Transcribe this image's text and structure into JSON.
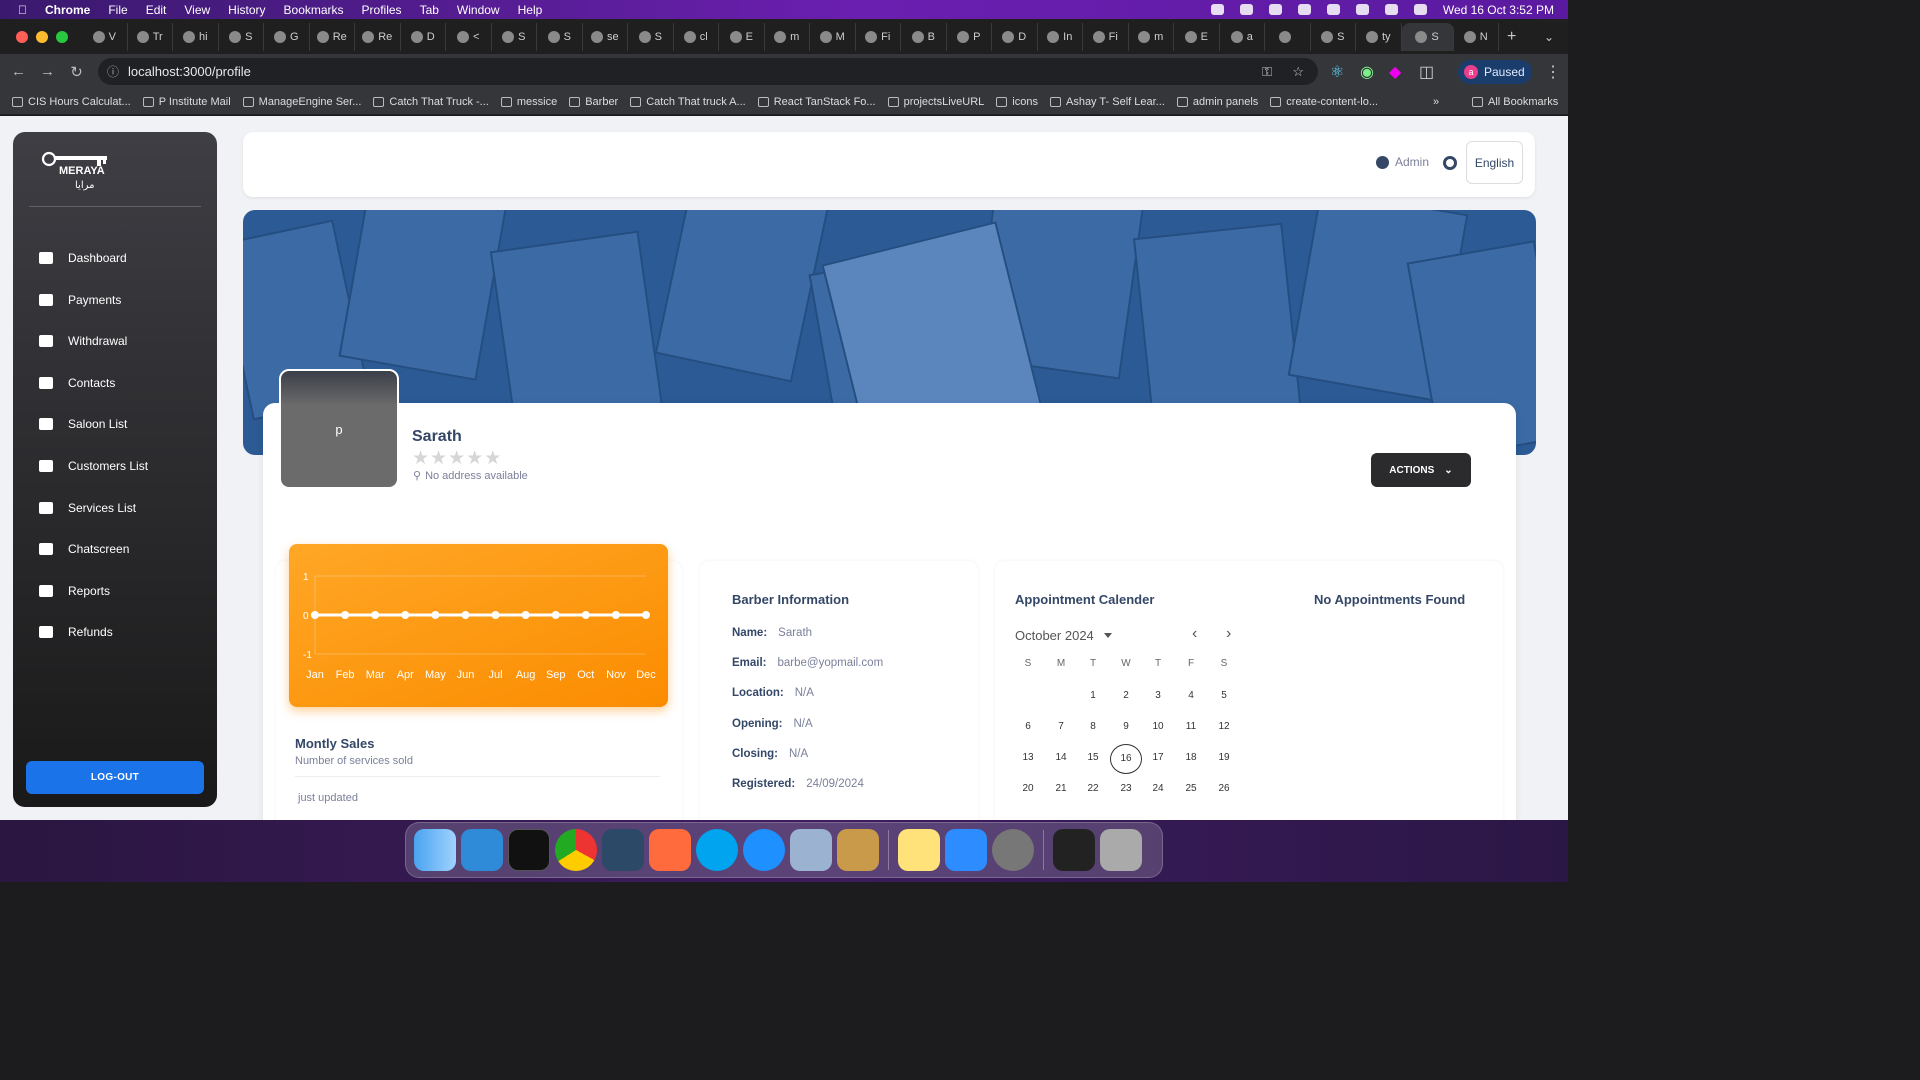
{
  "menubar": {
    "app": "Chrome",
    "items": [
      "File",
      "Edit",
      "View",
      "History",
      "Bookmarks",
      "Profiles",
      "Tab",
      "Window",
      "Help"
    ],
    "datetime": "Wed 16 Oct  3:52 PM"
  },
  "tabs": [
    "V",
    "Tr",
    "hi",
    "S",
    "G",
    "Re",
    "Re",
    "D",
    "<",
    "S",
    "S",
    "se",
    "S",
    "cl",
    "E",
    "m",
    "M",
    "Fi",
    "B",
    "P",
    "D",
    "In",
    "Fi",
    "m",
    "E",
    "a",
    "",
    "S",
    "ty",
    "S",
    "N"
  ],
  "address": {
    "url": "localhost:3000/profile",
    "paused": "Paused",
    "paused_avatar": "a"
  },
  "bookmarks": [
    "CIS Hours Calculat...",
    "P Institute Mail",
    "ManageEngine Ser...",
    "Catch That Truck -...",
    "messice",
    "Barber",
    "Catch That truck A...",
    "React TanStack Fo...",
    "projectsLiveURL",
    "icons",
    "Ashay T- Self Lear...",
    "admin panels",
    "create-content-lo..."
  ],
  "bookmarks_all": "All Bookmarks",
  "logo": {
    "name": "MERAYA",
    "arabic": "مرايا"
  },
  "sidebar": {
    "items": [
      {
        "label": "Dashboard",
        "icon": "dashboard-icon"
      },
      {
        "label": "Payments",
        "icon": "payments-icon"
      },
      {
        "label": "Withdrawal",
        "icon": "withdrawal-icon"
      },
      {
        "label": "Contacts",
        "icon": "phone-icon"
      },
      {
        "label": "Saloon List",
        "icon": "store-icon"
      },
      {
        "label": "Customers List",
        "icon": "user-circle-icon"
      },
      {
        "label": "Services List",
        "icon": "store-icon"
      },
      {
        "label": "Chatscreen",
        "icon": "chat-icon"
      },
      {
        "label": "Reports",
        "icon": "warning-icon"
      },
      {
        "label": "Refunds",
        "icon": "refunds-icon"
      }
    ],
    "logout": "LOG-OUT"
  },
  "topbar": {
    "user": "Admin",
    "language": "English"
  },
  "profile": {
    "avatar_letter": "p",
    "name": "Sarath",
    "rating": 0,
    "address": "No address available",
    "actions": "ACTIONS"
  },
  "sales": {
    "title": "Montly Sales",
    "subtitle": "Number of services sold",
    "updated": "just updated"
  },
  "chart_data": {
    "type": "line",
    "categories": [
      "Jan",
      "Feb",
      "Mar",
      "Apr",
      "May",
      "Jun",
      "Jul",
      "Aug",
      "Sep",
      "Oct",
      "Nov",
      "Dec"
    ],
    "values": [
      0,
      0,
      0,
      0,
      0,
      0,
      0,
      0,
      0,
      0,
      0,
      0
    ],
    "ylim": [
      -1,
      1
    ],
    "yticks": [
      "1",
      "0",
      "-1"
    ],
    "title": "",
    "xlabel": "",
    "ylabel": ""
  },
  "info": {
    "title": "Barber Information",
    "rows": [
      {
        "k": "Name:",
        "v": "Sarath"
      },
      {
        "k": "Email:",
        "v": "barbe@yopmail.com"
      },
      {
        "k": "Location:",
        "v": "N/A"
      },
      {
        "k": "Opening:",
        "v": "N/A"
      },
      {
        "k": "Closing:",
        "v": "N/A"
      },
      {
        "k": "Registered:",
        "v": "24/09/2024"
      }
    ]
  },
  "calendar": {
    "title": "Appointment Calender",
    "empty": "No Appointments Found",
    "month": "October 2024",
    "dow": [
      "S",
      "M",
      "T",
      "W",
      "T",
      "F",
      "S"
    ],
    "weeks": [
      [
        "",
        "",
        "1",
        "2",
        "3",
        "4",
        "5"
      ],
      [
        "6",
        "7",
        "8",
        "9",
        "10",
        "11",
        "12"
      ],
      [
        "13",
        "14",
        "15",
        "16",
        "17",
        "18",
        "19"
      ],
      [
        "20",
        "21",
        "22",
        "23",
        "24",
        "25",
        "26"
      ]
    ],
    "today": "16"
  }
}
